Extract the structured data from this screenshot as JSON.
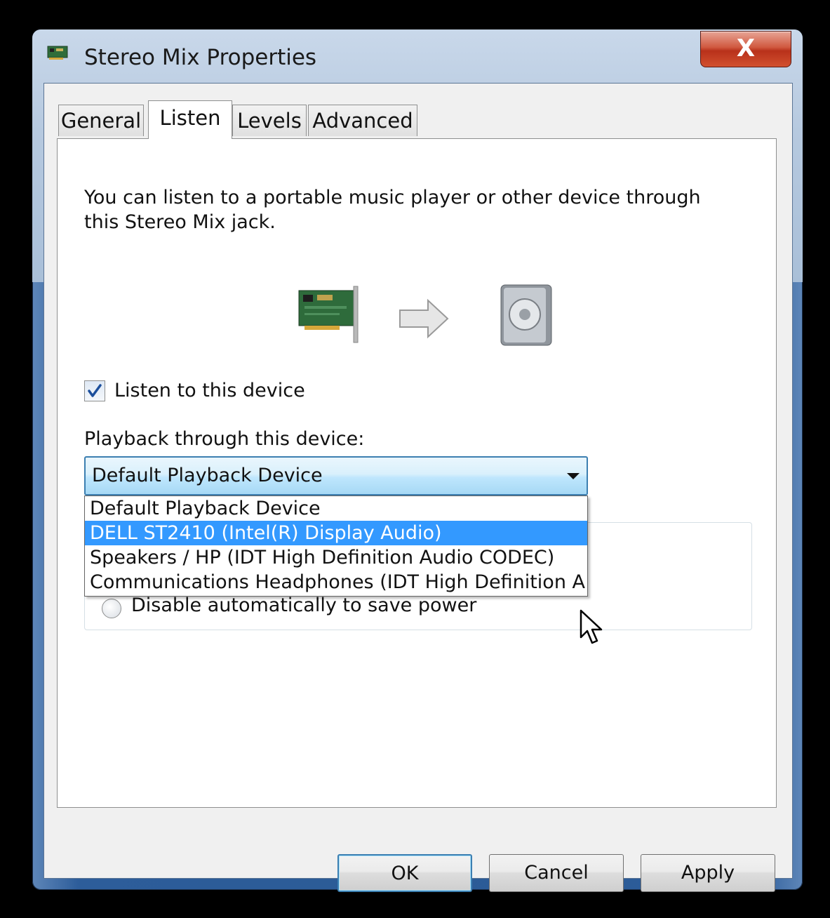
{
  "window": {
    "title": "Stereo Mix Properties",
    "close_label": "X"
  },
  "tabs": [
    {
      "label": "General"
    },
    {
      "label": "Listen",
      "active": true
    },
    {
      "label": "Levels"
    },
    {
      "label": "Advanced"
    }
  ],
  "listen": {
    "description": "You can listen to a portable music player or other device through this Stereo Mix jack.",
    "checkbox_label": "Listen to this device",
    "checkbox_checked": true,
    "playback_label": "Playback through this device:",
    "combo_value": "Default Playback Device",
    "dropdown_options": [
      "Default Playback Device",
      "DELL ST2410 (Intel(R) Display Audio)",
      "Speakers / HP (IDT High Definition Audio CODEC)",
      "Communications Headphones (IDT High Definition A"
    ],
    "dropdown_highlighted": "DELL ST2410 (Intel(R) Display Audio)",
    "power_option_label": "Disable automatically to save power"
  },
  "buttons": {
    "ok": "OK",
    "cancel": "Cancel",
    "apply": "Apply"
  },
  "icons": {
    "app": "sound-card-icon",
    "source": "sound-card-icon",
    "arrow": "arrow-right-icon",
    "speaker": "speaker-icon"
  }
}
